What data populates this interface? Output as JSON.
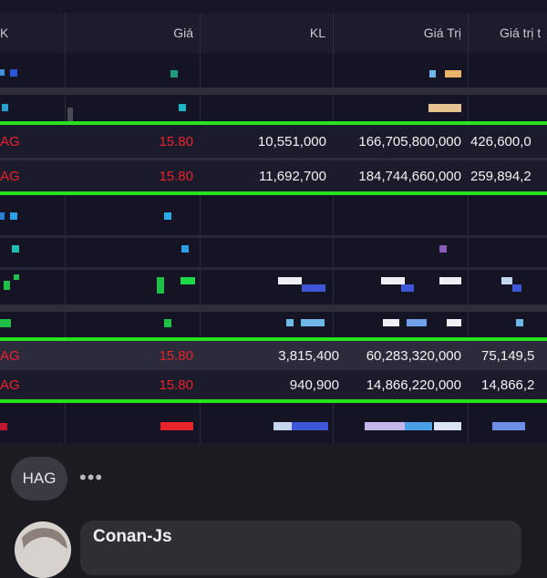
{
  "table": {
    "headers": [
      "K",
      "Giá",
      "KL",
      "Giá Trị",
      "Giá trị t"
    ],
    "rows": [
      {
        "sym": "AG",
        "price": "15.80",
        "kl": "10,551,000",
        "value": "166,705,800,000",
        "value2": "426,600,0"
      },
      {
        "sym": "AG",
        "price": "15.80",
        "kl": "11,692,700",
        "value": "184,744,660,000",
        "value2": "259,894,2"
      },
      {
        "sym": "AG",
        "price": "15.80",
        "kl": "3,815,400",
        "value": "60,283,320,000",
        "value2": "75,149,5"
      },
      {
        "sym": "AG",
        "price": "15.80",
        "kl": "940,900",
        "value": "14,866,220,000",
        "value2": "14,866,2"
      }
    ]
  },
  "colors": {
    "highlight": "#27e21c",
    "price_red": "#e8232c"
  },
  "post": {
    "tag": "HAG",
    "more": "•••",
    "commenter": "Conan-Js"
  }
}
